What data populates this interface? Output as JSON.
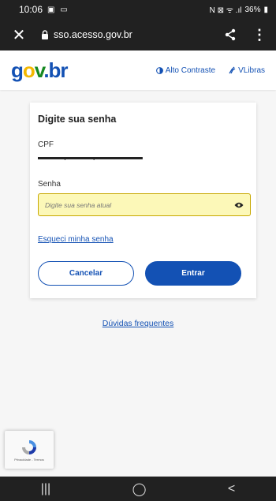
{
  "status_bar": {
    "time": "10:06",
    "left_icons": "▣ ▭",
    "right_icons": "N ⊠ ᯤ .ıl",
    "battery": "36%"
  },
  "browser": {
    "url": "sso.acesso.gov.br",
    "close_icon": "close-icon",
    "lock_icon": "lock-icon",
    "share_icon": "share-icon",
    "menu_icon": "more-vert-icon"
  },
  "header": {
    "logo": {
      "g": "g",
      "o": "o",
      "v": "v",
      "dot": ".",
      "br": "br"
    },
    "high_contrast": "Alto Contraste",
    "vlibras": "VLibras"
  },
  "login": {
    "title": "Digite sua senha",
    "cpf_label": "CPF",
    "cpf_value": "———.———.———-——",
    "password_label": "Senha",
    "password_placeholder": "Digite sua senha atual",
    "password_value": "",
    "forgot_link": "Esqueci minha senha",
    "cancel_label": "Cancelar",
    "enter_label": "Entrar"
  },
  "faq_link": "Dúvidas frequentes",
  "recaptcha": {
    "text": "Privacidade - Termos"
  },
  "nav": {
    "recent": "|||",
    "home": "◯",
    "back": "<"
  },
  "colors": {
    "primary": "#1351b4",
    "input_bg": "#fcf8b8",
    "dark_bar": "#212121"
  }
}
